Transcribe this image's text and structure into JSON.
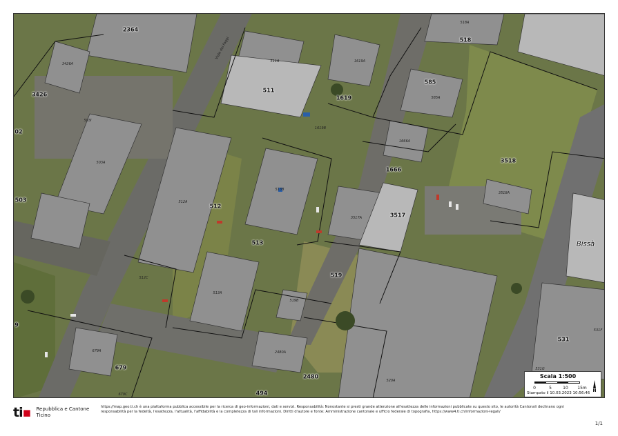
{
  "map": {
    "parcels": [
      {
        "id": "p2364",
        "label": "2364"
      },
      {
        "id": "p3426",
        "label": "3426"
      },
      {
        "id": "p02",
        "label": "02"
      },
      {
        "id": "p503",
        "label": "503"
      },
      {
        "id": "p511",
        "label": "511"
      },
      {
        "id": "p1619",
        "label": "1619"
      },
      {
        "id": "p518",
        "label": "518"
      },
      {
        "id": "p585",
        "label": "585"
      },
      {
        "id": "p1666",
        "label": "1666"
      },
      {
        "id": "p3518",
        "label": "3518"
      },
      {
        "id": "p512",
        "label": "512"
      },
      {
        "id": "p513",
        "label": "513"
      },
      {
        "id": "p3517",
        "label": "3517"
      },
      {
        "id": "p519",
        "label": "519"
      },
      {
        "id": "p679",
        "label": "679"
      },
      {
        "id": "p2480",
        "label": "2480"
      },
      {
        "id": "p494",
        "label": "494"
      },
      {
        "id": "p531",
        "label": "531"
      },
      {
        "id": "p9",
        "label": "9"
      }
    ],
    "buildings": [
      {
        "id": "b3426A",
        "label": "3426A"
      },
      {
        "id": "b503I",
        "label": "503I"
      },
      {
        "id": "b503A",
        "label": "503A"
      },
      {
        "id": "b511A",
        "label": "511A"
      },
      {
        "id": "b1619A",
        "label": "1619A"
      },
      {
        "id": "b1619B",
        "label": "1619B"
      },
      {
        "id": "b518A",
        "label": "518A"
      },
      {
        "id": "b585A",
        "label": "585A"
      },
      {
        "id": "b1666A",
        "label": "1666A"
      },
      {
        "id": "b3518A",
        "label": "3518A"
      },
      {
        "id": "b512A",
        "label": "512A"
      },
      {
        "id": "b513B",
        "label": "513B"
      },
      {
        "id": "b3517A",
        "label": "3517A"
      },
      {
        "id": "b513A",
        "label": "513A"
      },
      {
        "id": "b519B",
        "label": "519B"
      },
      {
        "id": "b679A",
        "label": "679A"
      },
      {
        "id": "b679C",
        "label": "679C"
      },
      {
        "id": "b2480A",
        "label": "2480A"
      },
      {
        "id": "b520A",
        "label": "520A"
      },
      {
        "id": "b531F",
        "label": "531F"
      },
      {
        "id": "b531G",
        "label": "531G"
      },
      {
        "id": "b512C",
        "label": "512C"
      }
    ],
    "street_label": "Viale dei Faggi",
    "place_label": "Bissà",
    "colors": {
      "roof": "#8e8e8e",
      "roof_light": "#a6a6a6",
      "vegetation": "#5d6b3a",
      "road": "#6a6a66",
      "parcel_line": "#111111"
    }
  },
  "scale": {
    "title": "Scala 1:500",
    "ticks": [
      "0",
      "5",
      "10",
      "15m"
    ],
    "printed": "Stampato il 10.03.2023 10:56:46",
    "north": "N"
  },
  "footer": {
    "logo_text": "ti",
    "org_line1": "Repubblica e Cantone",
    "org_line2": "Ticino",
    "disclaimer": "https://map.geo.ti.ch è una piattaforma pubblica accessibile per la ricerca di geo-informazioni, dati e servizi. Responsabilità: Nonostante si presti grande attenzione all'esattezza delle informazioni pubblicate su questo sito, le autorità Cantonali declinano ogni responsabilità per la fedeltà, l'esattezza, l'attualità, l'affidabilità e la completezza di tali informazioni. Diritti d'autore e fonte: Amministrazione cantonale e ufficio federale di topografia, https://www4.ti.ch/informazioni-legali/",
    "page": "1/1"
  }
}
